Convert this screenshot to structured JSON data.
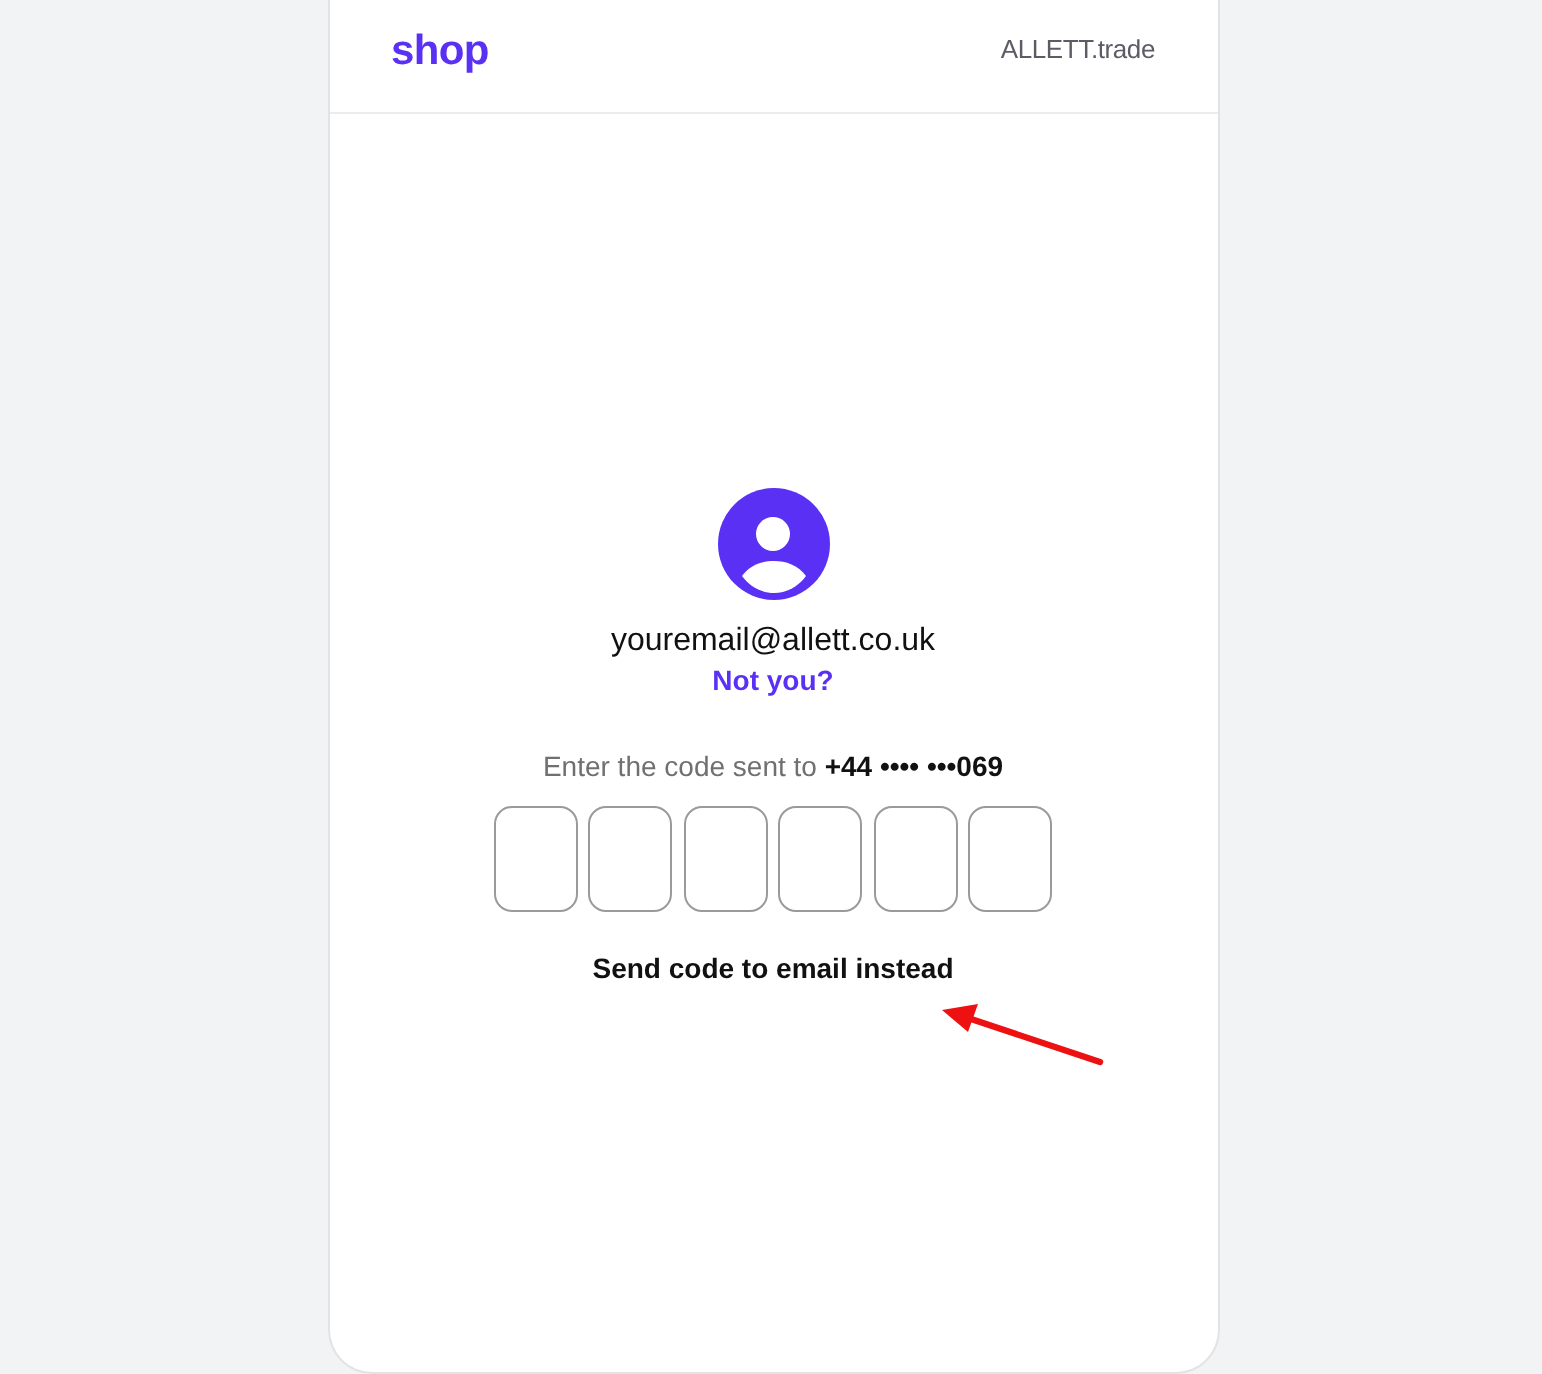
{
  "header": {
    "logo": "shop",
    "store": "ALLETT.trade"
  },
  "account": {
    "email": "youremail@allett.co.uk",
    "switch_link": "Not you?"
  },
  "verification": {
    "prompt": "Enter the code sent to **+44 •••• •••069**",
    "code_fields": [
      {
        "focused": false
      },
      {
        "focused": false
      },
      {
        "focused": false
      },
      {
        "focused": false
      },
      {
        "focused": false
      },
      {
        "focused": false
      }
    ],
    "alt_action": "Send code to email instead"
  }
}
